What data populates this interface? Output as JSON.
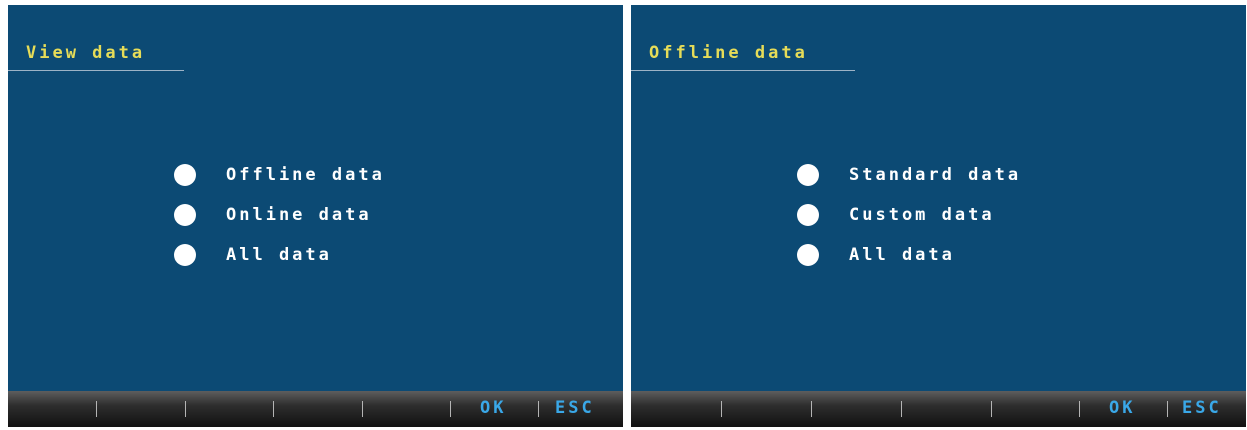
{
  "screens": [
    {
      "title": "View data",
      "options": [
        {
          "label": "Offline data"
        },
        {
          "label": "Online data"
        },
        {
          "label": "All data"
        }
      ],
      "softkeys": {
        "ok_label": "OK",
        "esc_label": "ESC"
      }
    },
    {
      "title": "Offline data",
      "options": [
        {
          "label": "Standard data"
        },
        {
          "label": "Custom data"
        },
        {
          "label": "All data"
        }
      ],
      "softkeys": {
        "ok_label": "OK",
        "esc_label": "ESC"
      }
    }
  ],
  "colors": {
    "screen_background": "#0c4a74",
    "title_text": "#e6dc58",
    "menu_text": "#ffffff",
    "softkey_text": "#3aa8e8"
  }
}
